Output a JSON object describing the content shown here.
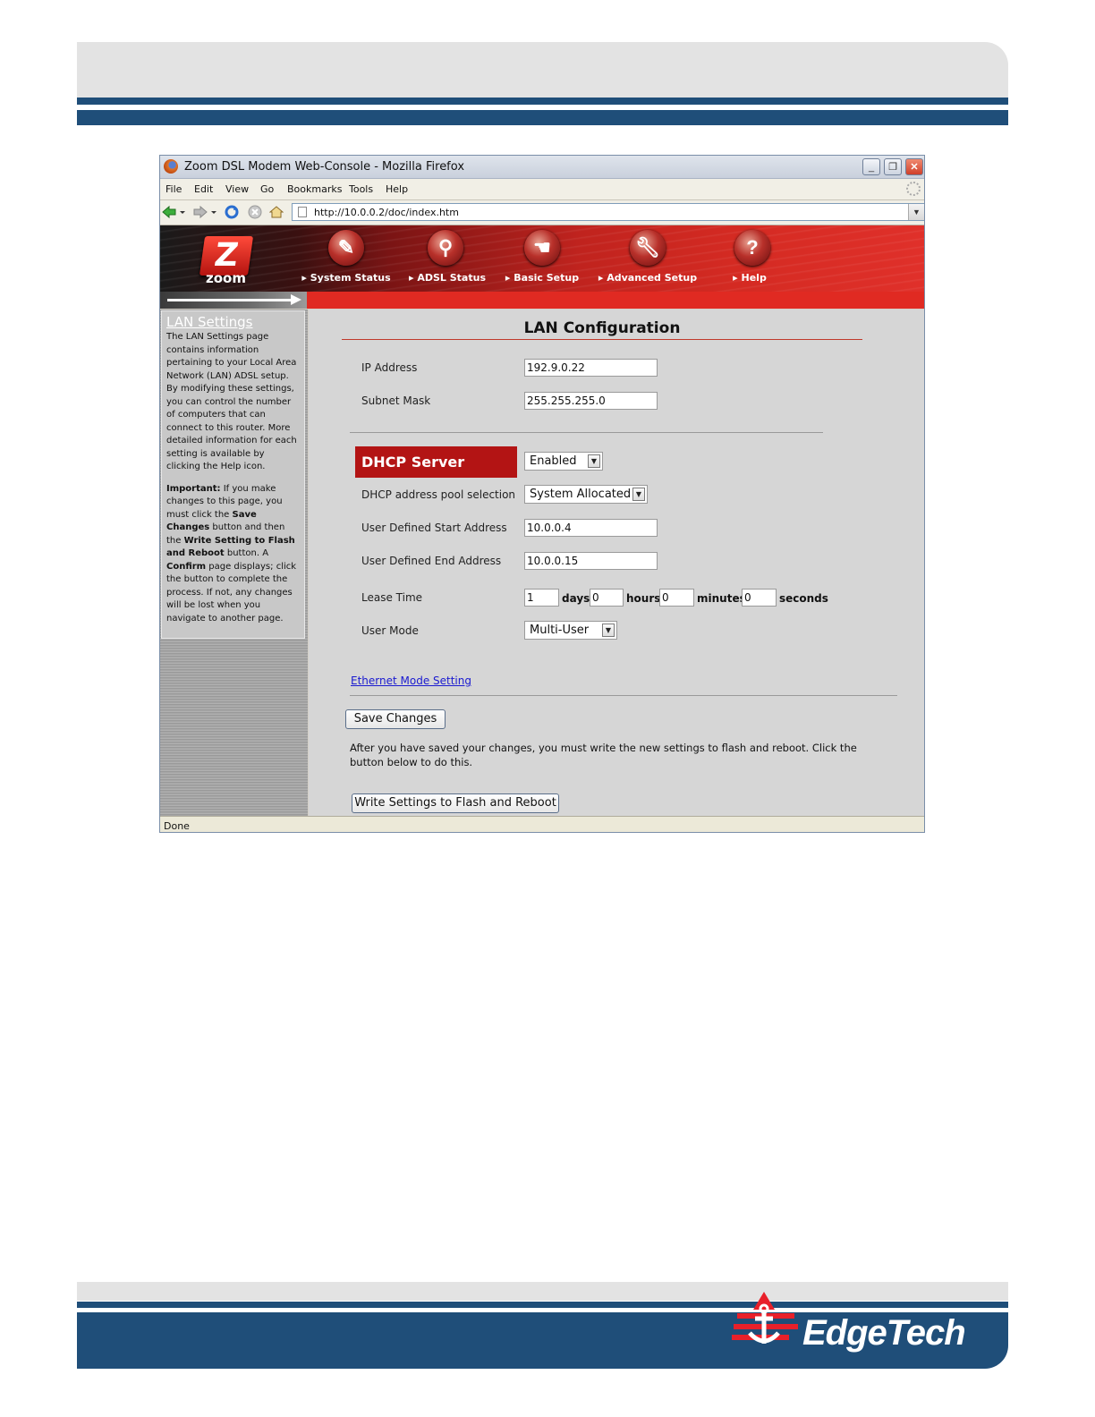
{
  "browser": {
    "title": "Zoom DSL Modem Web-Console - Mozilla Firefox",
    "menu": [
      "File",
      "Edit",
      "View",
      "Go",
      "Bookmarks",
      "Tools",
      "Help"
    ],
    "url": "http://10.0.0.2/doc/index.htm",
    "status": "Done"
  },
  "banner": {
    "logo_text": "zoom",
    "nav": [
      {
        "label": "System Status",
        "icon": "folder-icon"
      },
      {
        "label": "ADSL Status",
        "icon": "magnifier-icon"
      },
      {
        "label": "Basic Setup",
        "icon": "hand-icon"
      },
      {
        "label": "Advanced Setup",
        "icon": "wrench-icon"
      },
      {
        "label": "Help",
        "icon": "question-icon"
      }
    ]
  },
  "sidebar": {
    "title": "LAN Settings",
    "text1": "The LAN Settings page contains information pertaining to your Local Area Network (LAN) ADSL setup. By modifying these settings, you can control the number of computers that can connect to this router. More detailed information for each setting is available by clicking the Help icon.",
    "important_label": "Important:",
    "text2a": " If you make changes to this page, you must click the ",
    "save_label": "Save Changes",
    "text2b": " button and then the ",
    "write_label": "Write Setting to Flash and Reboot",
    "text2c": " button. A ",
    "confirm_label": "Confirm",
    "text2d": " page displays; click the button to complete the process. If not, any changes will be lost when you navigate to another page."
  },
  "main": {
    "title": "LAN Configuration",
    "ip_label": "IP Address",
    "ip_value": "192.9.0.22",
    "mask_label": "Subnet Mask",
    "mask_value": "255.255.255.0",
    "dhcp_header": "DHCP Server",
    "dhcp_value": "Enabled",
    "pool_label": "DHCP address pool selection",
    "pool_value": "System Allocated",
    "start_label": "User Defined Start Address",
    "start_value": "10.0.0.4",
    "end_label": "User Defined End Address",
    "end_value": "10.0.0.15",
    "lease_label": "Lease Time",
    "lease_days": "1",
    "days_unit": "days",
    "lease_hours": "0",
    "hours_unit": "hours",
    "lease_minutes": "0",
    "minutes_unit": "minutes",
    "lease_seconds": "0",
    "seconds_unit": "seconds",
    "mode_label": "User Mode",
    "mode_value": "Multi-User",
    "ethernet_link": "Ethernet Mode Setting",
    "save_button": "Save Changes",
    "note": "After you have saved your changes, you must write the new settings to flash and reboot. Click the button below to do this.",
    "write_button": "Write Settings to Flash and Reboot"
  },
  "footer": {
    "brand": "EdgeTech"
  },
  "colors": {
    "page_blue": "#1f4e79",
    "banner_red": "#e02a22",
    "dhcp_red": "#b31414"
  }
}
